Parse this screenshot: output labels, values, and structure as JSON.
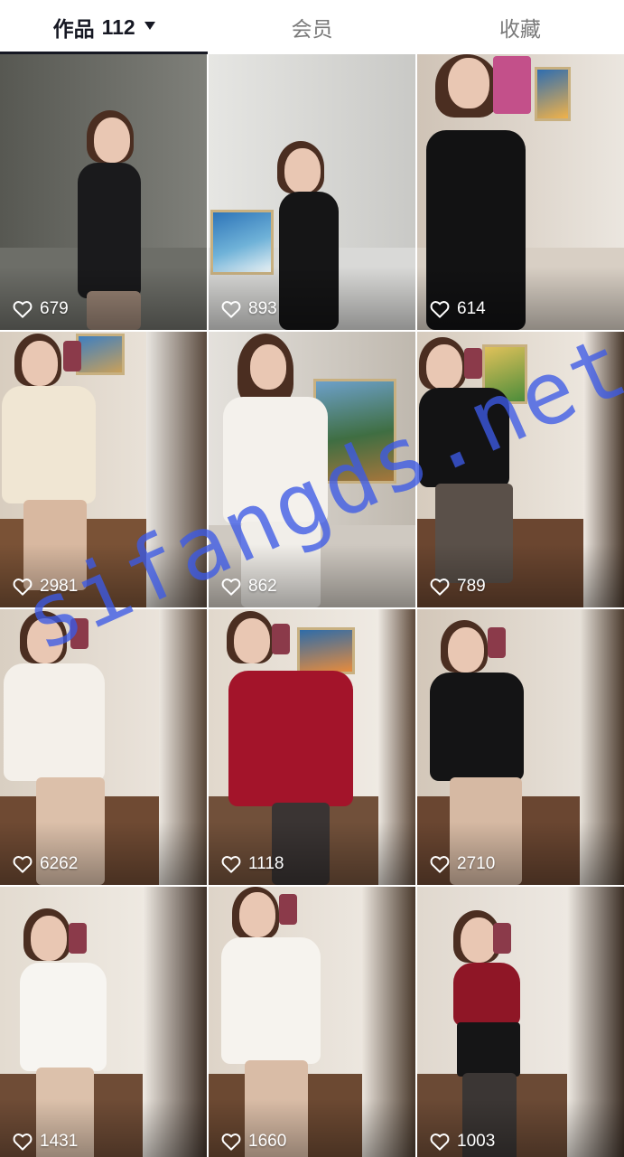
{
  "tabs": [
    {
      "label": "作品",
      "count": "112",
      "active": true
    },
    {
      "label": "会员",
      "active": false
    },
    {
      "label": "收藏",
      "active": false
    }
  ],
  "videos": [
    {
      "likes": "679"
    },
    {
      "likes": "893"
    },
    {
      "likes": "614"
    },
    {
      "likes": "2981"
    },
    {
      "likes": "862"
    },
    {
      "likes": "789"
    },
    {
      "likes": "6262"
    },
    {
      "likes": "1118"
    },
    {
      "likes": "2710"
    },
    {
      "likes": "1431"
    },
    {
      "likes": "1660"
    },
    {
      "likes": "1003"
    }
  ],
  "watermark": "sifangds.net",
  "colors": {
    "active_tab_text": "#161823",
    "inactive_tab_text": "#7a7a7a",
    "watermark": "#3c5ae6"
  }
}
